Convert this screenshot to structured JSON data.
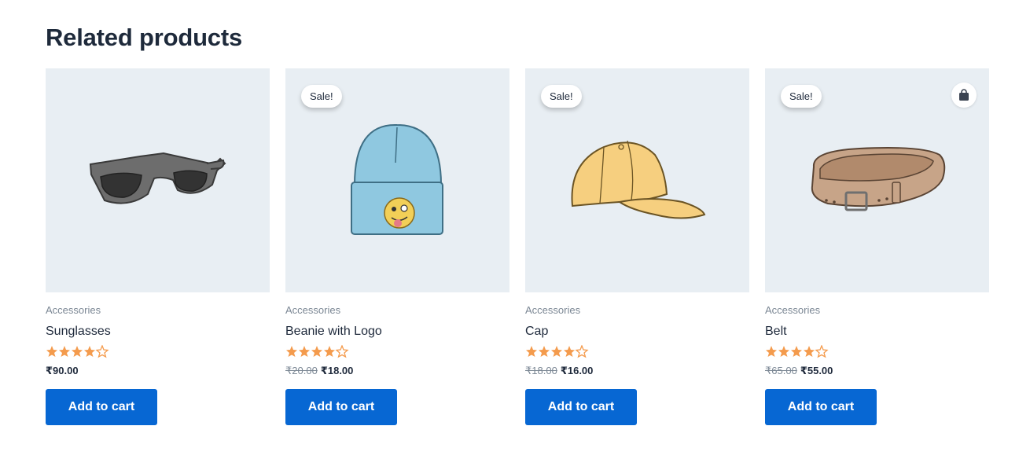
{
  "section": {
    "title": "Related products"
  },
  "colors": {
    "accent": "#0767d3",
    "star": "#f49b4d",
    "thumb_bg": "#e8eef3"
  },
  "products": [
    {
      "category": "Accessories",
      "title": "Sunglasses",
      "rating": 4.5,
      "price": "₹90.00",
      "old_price": "",
      "sale_badge": "",
      "button_label": "Add to cart",
      "image": "sunglasses-icon"
    },
    {
      "category": "Accessories",
      "title": "Beanie with Logo",
      "rating": 4.5,
      "price": "₹18.00",
      "old_price": "₹20.00",
      "sale_badge": "Sale!",
      "button_label": "Add to cart",
      "image": "beanie-icon"
    },
    {
      "category": "Accessories",
      "title": "Cap",
      "rating": 4.5,
      "price": "₹16.00",
      "old_price": "₹18.00",
      "sale_badge": "Sale!",
      "button_label": "Add to cart",
      "image": "cap-icon"
    },
    {
      "category": "Accessories",
      "title": "Belt",
      "rating": 4.5,
      "price": "₹55.00",
      "old_price": "₹65.00",
      "sale_badge": "Sale!",
      "button_label": "Add to cart",
      "image": "belt-icon",
      "quick_icon": "shopping-bag-icon"
    }
  ]
}
